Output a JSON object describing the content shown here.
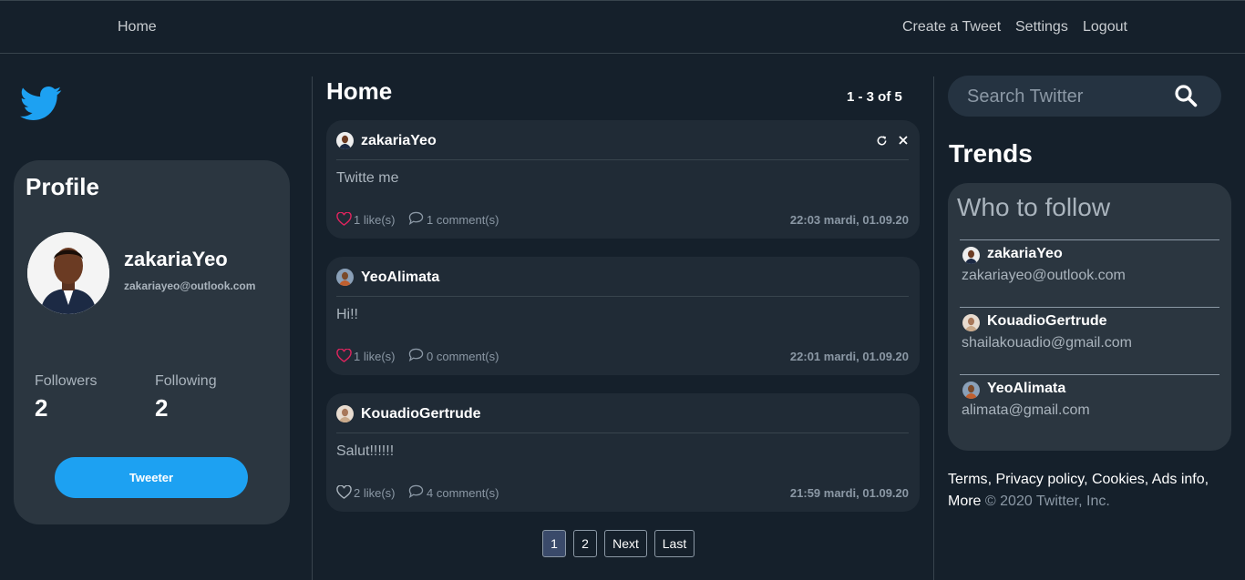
{
  "nav": {
    "home": "Home",
    "create": "Create a Tweet",
    "settings": "Settings",
    "logout": "Logout"
  },
  "profile": {
    "title": "Profile",
    "name": "zakariaYeo",
    "email": "zakariayeo@outlook.com",
    "followers_label": "Followers",
    "followers": "2",
    "following_label": "Following",
    "following": "2",
    "button": "Tweeter"
  },
  "feed": {
    "title": "Home",
    "range": "1 - 3 of 5",
    "tweets": [
      {
        "user": "zakariaYeo",
        "text": "Twitte me",
        "likes": "1 like(s)",
        "comments": "1 comment(s)",
        "time": "22:03 mardi, 01.09.20",
        "liked": true
      },
      {
        "user": "YeoAlimata",
        "text": "Hi!!",
        "likes": "1 like(s)",
        "comments": "0 comment(s)",
        "time": "22:01 mardi, 01.09.20",
        "liked": true
      },
      {
        "user": "KouadioGertrude",
        "text": "Salut!!!!!!",
        "likes": "2 like(s)",
        "comments": "4 comment(s)",
        "time": "21:59 mardi, 01.09.20",
        "liked": false
      }
    ],
    "pagination": {
      "p1": "1",
      "p2": "2",
      "next": "Next",
      "last": "Last",
      "current": 1
    }
  },
  "sidebar": {
    "search_placeholder": "Search Twitter",
    "trends": "Trends",
    "who_to_follow": "Who to follow",
    "suggestions": [
      {
        "name": "zakariaYeo",
        "email": "zakariayeo@outlook.com"
      },
      {
        "name": "KouadioGertrude",
        "email": "shailakouadio@gmail.com"
      },
      {
        "name": "YeoAlimata",
        "email": "alimata@gmail.com"
      }
    ]
  },
  "footer": {
    "terms": "Terms",
    "privacy": "Privacy policy",
    "cookies": "Cookies",
    "ads": "Ads info",
    "more": "More",
    "copyright": "© 2020 Twitter, Inc."
  },
  "colors": {
    "accent": "#1da1f2",
    "background": "#15202b",
    "card": "#2b3640",
    "like": "#e0245e"
  }
}
